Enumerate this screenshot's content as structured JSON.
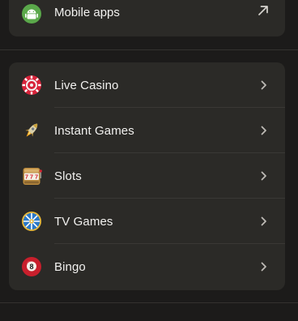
{
  "mobile_apps": {
    "label": "Mobile apps",
    "icon": "android-icon",
    "action_icon": "external-link-arrow-icon"
  },
  "games_menu": {
    "items": [
      {
        "label": "Live Casino",
        "icon": "casino-chip-icon"
      },
      {
        "label": "Instant Games",
        "icon": "rocket-icon"
      },
      {
        "label": "Slots",
        "icon": "slot-machine-icon"
      },
      {
        "label": "TV Games",
        "icon": "wheel-icon"
      },
      {
        "label": "Bingo",
        "icon": "bingo-ball-icon"
      }
    ]
  },
  "colors": {
    "background": "#1c1b1a",
    "card": "#2b2a27",
    "text": "#f2f1ef",
    "separator": "#3a3835",
    "chevron": "#bdbab5"
  }
}
